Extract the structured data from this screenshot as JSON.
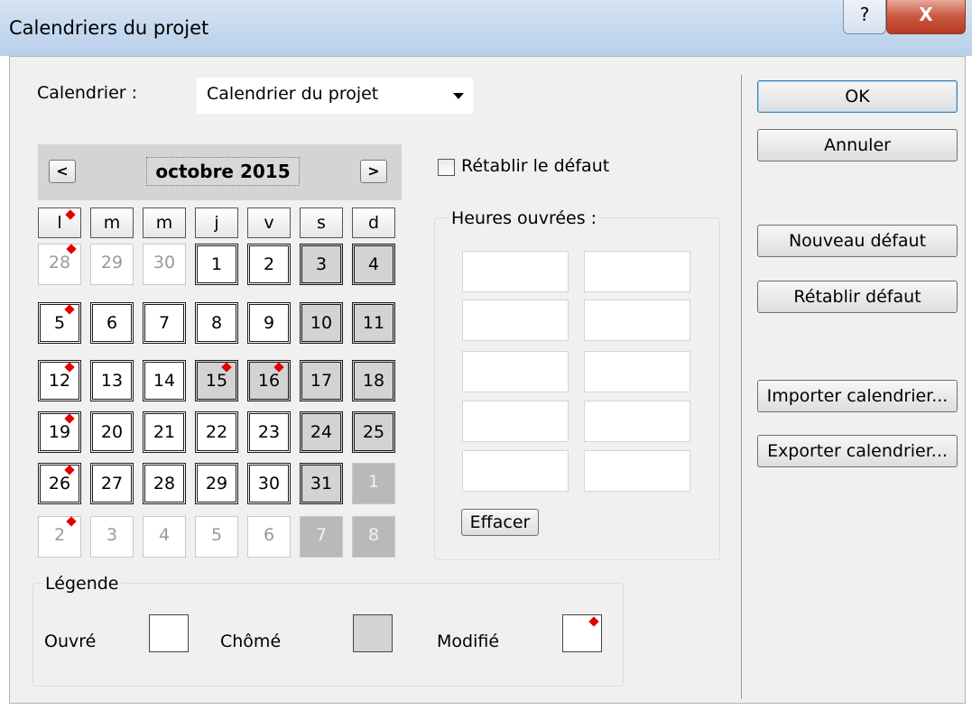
{
  "window": {
    "title": "Calendriers du projet",
    "help_glyph": "?",
    "close_glyph": "X"
  },
  "calendar_select": {
    "label": "Calendrier :",
    "value": "Calendrier du projet"
  },
  "month_nav": {
    "prev": "<",
    "next": ">",
    "month": "octobre 2015"
  },
  "weekdays": [
    "l",
    "m",
    "m",
    "j",
    "v",
    "s",
    "d"
  ],
  "weekdays_modified": [
    true,
    false,
    false,
    false,
    false,
    false,
    false
  ],
  "weeks": [
    [
      {
        "d": "28",
        "o": true,
        "m": true
      },
      {
        "d": "29",
        "o": true
      },
      {
        "d": "30",
        "o": true
      },
      {
        "d": "1"
      },
      {
        "d": "2"
      },
      {
        "d": "3",
        "c": true
      },
      {
        "d": "4",
        "c": true
      }
    ],
    [
      {
        "d": "5",
        "m": true
      },
      {
        "d": "6"
      },
      {
        "d": "7"
      },
      {
        "d": "8"
      },
      {
        "d": "9"
      },
      {
        "d": "10",
        "c": true
      },
      {
        "d": "11",
        "c": true
      }
    ],
    [
      {
        "d": "12",
        "m": true
      },
      {
        "d": "13"
      },
      {
        "d": "14"
      },
      {
        "d": "15",
        "c": true,
        "m": true
      },
      {
        "d": "16",
        "c": true,
        "m": true
      },
      {
        "d": "17",
        "c": true
      },
      {
        "d": "18",
        "c": true
      }
    ],
    [
      {
        "d": "19",
        "m": true
      },
      {
        "d": "20"
      },
      {
        "d": "21"
      },
      {
        "d": "22"
      },
      {
        "d": "23"
      },
      {
        "d": "24",
        "c": true
      },
      {
        "d": "25",
        "c": true
      }
    ],
    [
      {
        "d": "26",
        "m": true
      },
      {
        "d": "27"
      },
      {
        "d": "28"
      },
      {
        "d": "29"
      },
      {
        "d": "30"
      },
      {
        "d": "31",
        "c": true
      },
      {
        "d": "1",
        "o": true,
        "c": true
      }
    ],
    [
      {
        "d": "2",
        "o": true,
        "m": true
      },
      {
        "d": "3",
        "o": true
      },
      {
        "d": "4",
        "o": true
      },
      {
        "d": "5",
        "o": true
      },
      {
        "d": "6",
        "o": true
      },
      {
        "d": "7",
        "o": true,
        "c": true
      },
      {
        "d": "8",
        "o": true,
        "c": true
      }
    ]
  ],
  "reset_default": {
    "label": "Rétablir le défaut",
    "checked": false
  },
  "hours": {
    "title": "Heures ouvrées :",
    "fields": [
      "",
      "",
      "",
      "",
      "",
      "",
      "",
      "",
      "",
      ""
    ],
    "clear_label": "Effacer"
  },
  "legend": {
    "title": "Légende",
    "worked": "Ouvré",
    "nonworked": "Chômé",
    "modified": "Modifié"
  },
  "buttons": {
    "ok": "OK",
    "cancel": "Annuler",
    "new_default": "Nouveau défaut",
    "restore_default": "Rétablir défaut",
    "import": "Importer calendrier...",
    "export": "Exporter calendrier..."
  },
  "colors": {
    "worked": "#ffffff",
    "nonworked": "#d3d3d3",
    "modified_marker": "#e00000"
  }
}
